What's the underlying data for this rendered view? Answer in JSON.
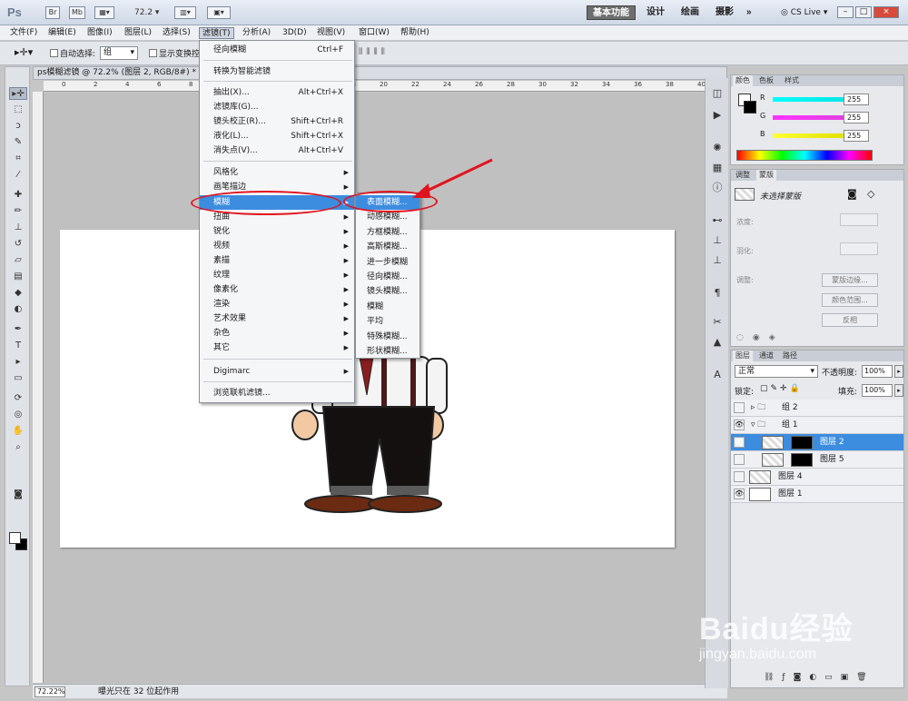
{
  "app": {
    "logo": "Ps",
    "zoom_value": "72.2",
    "workspaces": [
      "基本功能",
      "设计",
      "绘画",
      "摄影",
      "»"
    ],
    "cs_live": "CS Live",
    "window_buttons": [
      "–",
      "□",
      "×"
    ]
  },
  "menubar": [
    "文件(F)",
    "编辑(E)",
    "图像(I)",
    "图层(L)",
    "选择(S)",
    "滤镜(T)",
    "分析(A)",
    "3D(D)",
    "视图(V)",
    "窗口(W)",
    "帮助(H)"
  ],
  "options_bar": {
    "auto_select_label": "自动选择:",
    "auto_select_value": "组",
    "show_transform_label": "显示变换控"
  },
  "document": {
    "tab_title": "ps模糊滤镜 @ 72.2% (图层 2, RGB/8#) *",
    "ruler_ticks": [
      "0",
      "2",
      "4",
      "6",
      "8",
      "10",
      "12",
      "14",
      "16",
      "18",
      "20",
      "22",
      "24",
      "26",
      "28",
      "30",
      "32",
      "34",
      "36",
      "38",
      "40"
    ],
    "status_zoom": "72.22%",
    "status_text": "曝光只在 32 位起作用"
  },
  "filter_menu": {
    "items": [
      {
        "label": "径向模糊",
        "shortcut": "Ctrl+F"
      },
      {
        "label": "转换为智能滤镜",
        "shortcut": ""
      },
      {
        "label": "抽出(X)...",
        "shortcut": "Alt+Ctrl+X"
      },
      {
        "label": "滤镜库(G)...",
        "shortcut": ""
      },
      {
        "label": "镜头校正(R)...",
        "shortcut": "Shift+Ctrl+R"
      },
      {
        "label": "液化(L)...",
        "shortcut": "Shift+Ctrl+X"
      },
      {
        "label": "消失点(V)...",
        "shortcut": "Alt+Ctrl+V"
      },
      {
        "label": "风格化",
        "shortcut": ""
      },
      {
        "label": "画笔描边",
        "shortcut": ""
      },
      {
        "label": "模糊",
        "shortcut": ""
      },
      {
        "label": "扭曲",
        "shortcut": ""
      },
      {
        "label": "锐化",
        "shortcut": ""
      },
      {
        "label": "视频",
        "shortcut": ""
      },
      {
        "label": "素描",
        "shortcut": ""
      },
      {
        "label": "纹理",
        "shortcut": ""
      },
      {
        "label": "像素化",
        "shortcut": ""
      },
      {
        "label": "渲染",
        "shortcut": ""
      },
      {
        "label": "艺术效果",
        "shortcut": ""
      },
      {
        "label": "杂色",
        "shortcut": ""
      },
      {
        "label": "其它",
        "shortcut": ""
      },
      {
        "label": "Digimarc",
        "shortcut": ""
      },
      {
        "label": "浏览联机滤镜...",
        "shortcut": ""
      }
    ],
    "submenu_arrow": "▶"
  },
  "blur_submenu": [
    "表面模糊...",
    "动感模糊...",
    "方框模糊...",
    "高斯模糊...",
    "进一步模糊",
    "径向模糊...",
    "镜头模糊...",
    "模糊",
    "平均",
    "特殊模糊...",
    "形状模糊..."
  ],
  "color_panel": {
    "tabs": [
      "颜色",
      "色板",
      "样式"
    ],
    "channels": [
      {
        "label": "R",
        "value": "255",
        "color": "#00e0e0"
      },
      {
        "label": "G",
        "value": "255",
        "color": "#e040e0"
      },
      {
        "label": "B",
        "value": "255",
        "color": "#e0e000"
      }
    ]
  },
  "masks_panel": {
    "tabs": [
      "调整",
      "蒙版"
    ],
    "title": "未选择蒙版",
    "density_label": "浓度:",
    "feather_label": "羽化:",
    "refine_label": "调整:",
    "buttons": [
      "蒙版边缘...",
      "颜色范围...",
      "反相"
    ]
  },
  "layers_panel": {
    "tabs": [
      "图层",
      "通道",
      "路径"
    ],
    "blend_mode": "正常",
    "opacity_label": "不透明度:",
    "opacity_value": "100%",
    "lock_label": "锁定:",
    "fill_label": "填充:",
    "fill_value": "100%",
    "layers": [
      {
        "name": "组 2",
        "visible": false,
        "selected": false,
        "kind": "group"
      },
      {
        "name": "组 1",
        "visible": true,
        "selected": false,
        "kind": "group"
      },
      {
        "name": "图层 2",
        "visible": true,
        "selected": true,
        "kind": "layer"
      },
      {
        "name": "图层 5",
        "visible": false,
        "selected": false,
        "kind": "layer"
      },
      {
        "name": "图层 4",
        "visible": false,
        "selected": false,
        "kind": "layer"
      },
      {
        "name": "图层 1",
        "visible": true,
        "selected": false,
        "kind": "layer"
      }
    ],
    "footer_icons": [
      "link-icon",
      "fx-icon",
      "mask-icon",
      "adjustment-icon",
      "folder-icon",
      "new-layer-icon",
      "trash-icon"
    ]
  },
  "watermark": {
    "main": "Baidu经验",
    "sub": "jingyan.baidu.com"
  }
}
